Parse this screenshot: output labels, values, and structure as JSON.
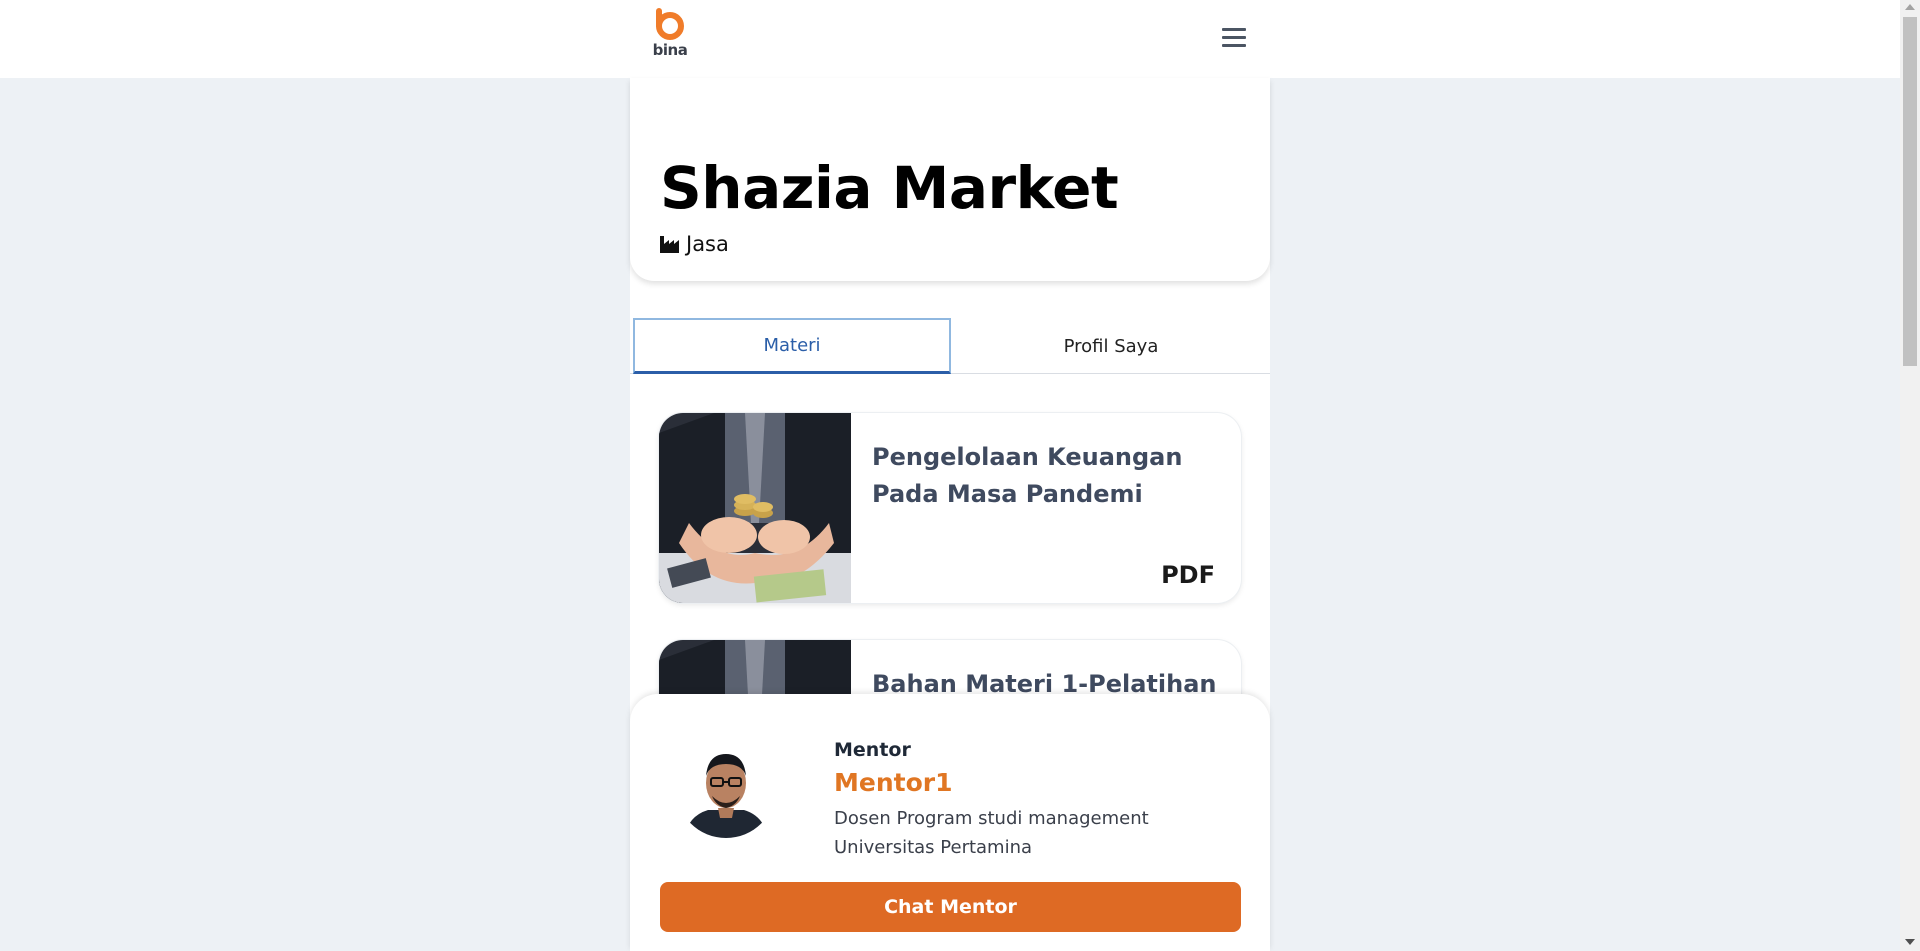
{
  "nav": {
    "logo_text": "bina",
    "logo_color": "#f07c2a",
    "menu_icon": "hamburger-icon"
  },
  "business": {
    "name": "Shazia Market",
    "category": "Jasa",
    "category_icon": "industry-icon"
  },
  "tabs": [
    {
      "label": "Materi",
      "active": true
    },
    {
      "label": "Profil Saya",
      "active": false
    }
  ],
  "materials": [
    {
      "title": "Pengelolaan Keuangan Pada Masa Pandemi",
      "type": "PDF"
    },
    {
      "title": "Bahan Materi 1-Pelatihan",
      "type": ""
    }
  ],
  "mentor": {
    "caption": "Mentor",
    "name": "Mentor1",
    "bio": "Dosen Program studi management Universitas Pertamina",
    "chat_button": "Chat Mentor"
  },
  "colors": {
    "accent_orange": "#de6a24",
    "mentor_name": "#e07623",
    "tab_active": "#2b5ea8",
    "background": "#edf1f5"
  }
}
